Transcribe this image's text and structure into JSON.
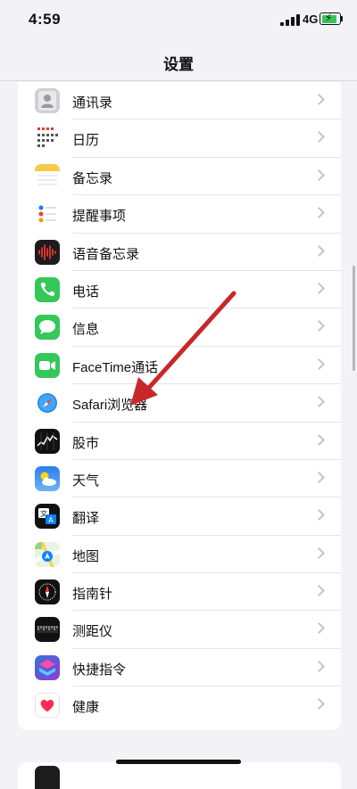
{
  "status_bar": {
    "time": "4:59",
    "network": "4G",
    "battery_state": "charging"
  },
  "nav": {
    "title": "设置"
  },
  "settings_items": [
    {
      "label": "通讯录",
      "icon": "contacts-icon"
    },
    {
      "label": "日历",
      "icon": "calendar-icon"
    },
    {
      "label": "备忘录",
      "icon": "notes-icon"
    },
    {
      "label": "提醒事项",
      "icon": "reminders-icon"
    },
    {
      "label": "语音备忘录",
      "icon": "voice-memos-icon"
    },
    {
      "label": "电话",
      "icon": "phone-icon"
    },
    {
      "label": "信息",
      "icon": "messages-icon"
    },
    {
      "label": "FaceTime通话",
      "icon": "facetime-icon"
    },
    {
      "label": "Safari浏览器",
      "icon": "safari-icon"
    },
    {
      "label": "股市",
      "icon": "stocks-icon"
    },
    {
      "label": "天气",
      "icon": "weather-icon"
    },
    {
      "label": "翻译",
      "icon": "translate-icon"
    },
    {
      "label": "地图",
      "icon": "maps-icon"
    },
    {
      "label": "指南针",
      "icon": "compass-icon"
    },
    {
      "label": "测距仪",
      "icon": "measure-icon"
    },
    {
      "label": "快捷指令",
      "icon": "shortcuts-icon"
    },
    {
      "label": "健康",
      "icon": "health-icon"
    }
  ],
  "annotation": {
    "type": "red-arrow",
    "points_to": "Safari浏览器"
  },
  "colors": {
    "background": "#f2f2f7",
    "arrow": "#c8272b",
    "phone": "#34c759",
    "messages": "#34c759",
    "facetime": "#34c759",
    "shortcuts": "#6a4de0",
    "health_heart": "#ff2d55",
    "battery_fill": "#34c759"
  }
}
